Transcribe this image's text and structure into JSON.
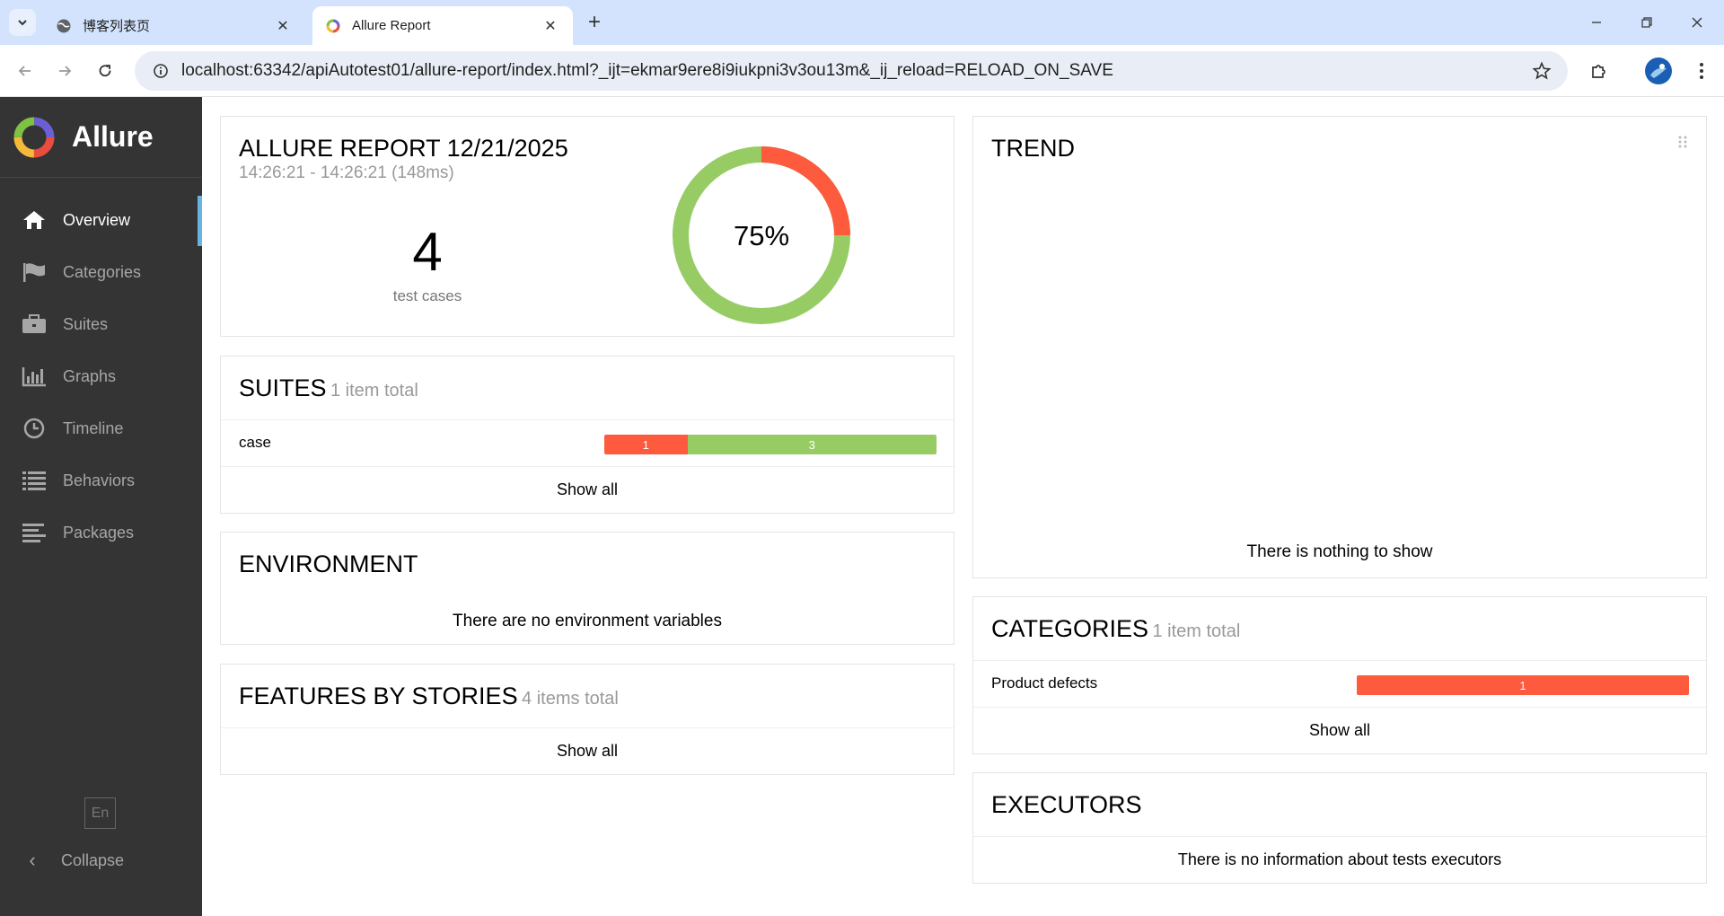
{
  "browser": {
    "tabs": [
      {
        "title": "博客列表页",
        "active": false
      },
      {
        "title": "Allure Report",
        "active": true
      }
    ],
    "url": "localhost:63342/apiAutotest01/allure-report/index.html?_ijt=ekmar9ere8i9iukpni3v3ou13m&_ij_reload=RELOAD_ON_SAVE"
  },
  "sidebar": {
    "brand": "Allure",
    "items": [
      {
        "label": "Overview",
        "icon": "home-icon",
        "active": true
      },
      {
        "label": "Categories",
        "icon": "flag-icon",
        "active": false
      },
      {
        "label": "Suites",
        "icon": "briefcase-icon",
        "active": false
      },
      {
        "label": "Graphs",
        "icon": "bar-chart-icon",
        "active": false
      },
      {
        "label": "Timeline",
        "icon": "clock-icon",
        "active": false
      },
      {
        "label": "Behaviors",
        "icon": "list-icon",
        "active": false
      },
      {
        "label": "Packages",
        "icon": "align-left-icon",
        "active": false
      }
    ],
    "language": "En",
    "collapse": "Collapse"
  },
  "summary": {
    "title": "ALLURE REPORT 12/21/2025",
    "time": "14:26:21 - 14:26:21 (148ms)",
    "count": "4",
    "count_label": "test cases",
    "percent": "75%",
    "passed": 3,
    "failed": 1
  },
  "suites": {
    "title": "SUITES",
    "count": "1 item total",
    "rows": [
      {
        "name": "case",
        "failed": "1",
        "passed": "3"
      }
    ],
    "show_all": "Show all"
  },
  "environment": {
    "title": "ENVIRONMENT",
    "empty": "There are no environment variables"
  },
  "features": {
    "title": "FEATURES BY STORIES",
    "count": "4 items total",
    "show_all": "Show all"
  },
  "trend": {
    "title": "TREND",
    "empty": "There is nothing to show"
  },
  "categories": {
    "title": "CATEGORIES",
    "count": "1 item total",
    "rows": [
      {
        "name": "Product defects",
        "failed": "1"
      }
    ],
    "show_all": "Show all"
  },
  "executors": {
    "title": "EXECUTORS",
    "empty": "There is no information about tests executors"
  },
  "colors": {
    "failed": "#fd5a3e",
    "passed": "#97cc64",
    "sidebar": "#343434",
    "accent": "#6ab3e0"
  }
}
